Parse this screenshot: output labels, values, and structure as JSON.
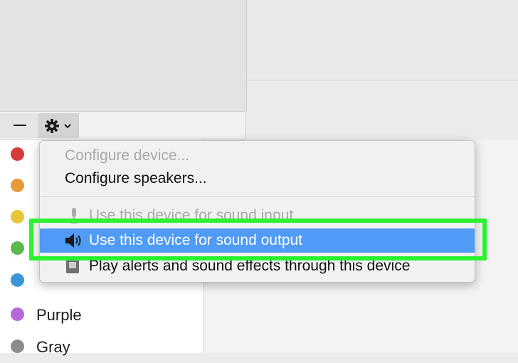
{
  "toolbar": {
    "remove_icon": "minus-icon",
    "action_icon": "gear-icon",
    "dropdown_icon": "chevron-down-icon"
  },
  "tags": [
    {
      "label": "",
      "color": "#d63a3a"
    },
    {
      "label": "",
      "color": "#e89a3a"
    },
    {
      "label": "",
      "color": "#e8c53a"
    },
    {
      "label": "",
      "color": "#5cb84a"
    },
    {
      "label": "",
      "color": "#3a96d8"
    },
    {
      "label": "Purple",
      "color": "#b46ad6"
    },
    {
      "label": "Gray",
      "color": "#8c8c8c"
    }
  ],
  "menu": {
    "configure_device": "Configure device...",
    "configure_speakers": "Configure speakers...",
    "sound_input": "Use this device for sound input",
    "sound_output": "Use this device for sound output",
    "alerts": "Play alerts and sound effects through this device",
    "input_icon": "microphone-icon",
    "output_icon": "speaker-icon",
    "alerts_icon": "alert-icon"
  },
  "colors": {
    "highlight_fill": "#4f9bf5",
    "emphasis_outline": "#2df230"
  }
}
